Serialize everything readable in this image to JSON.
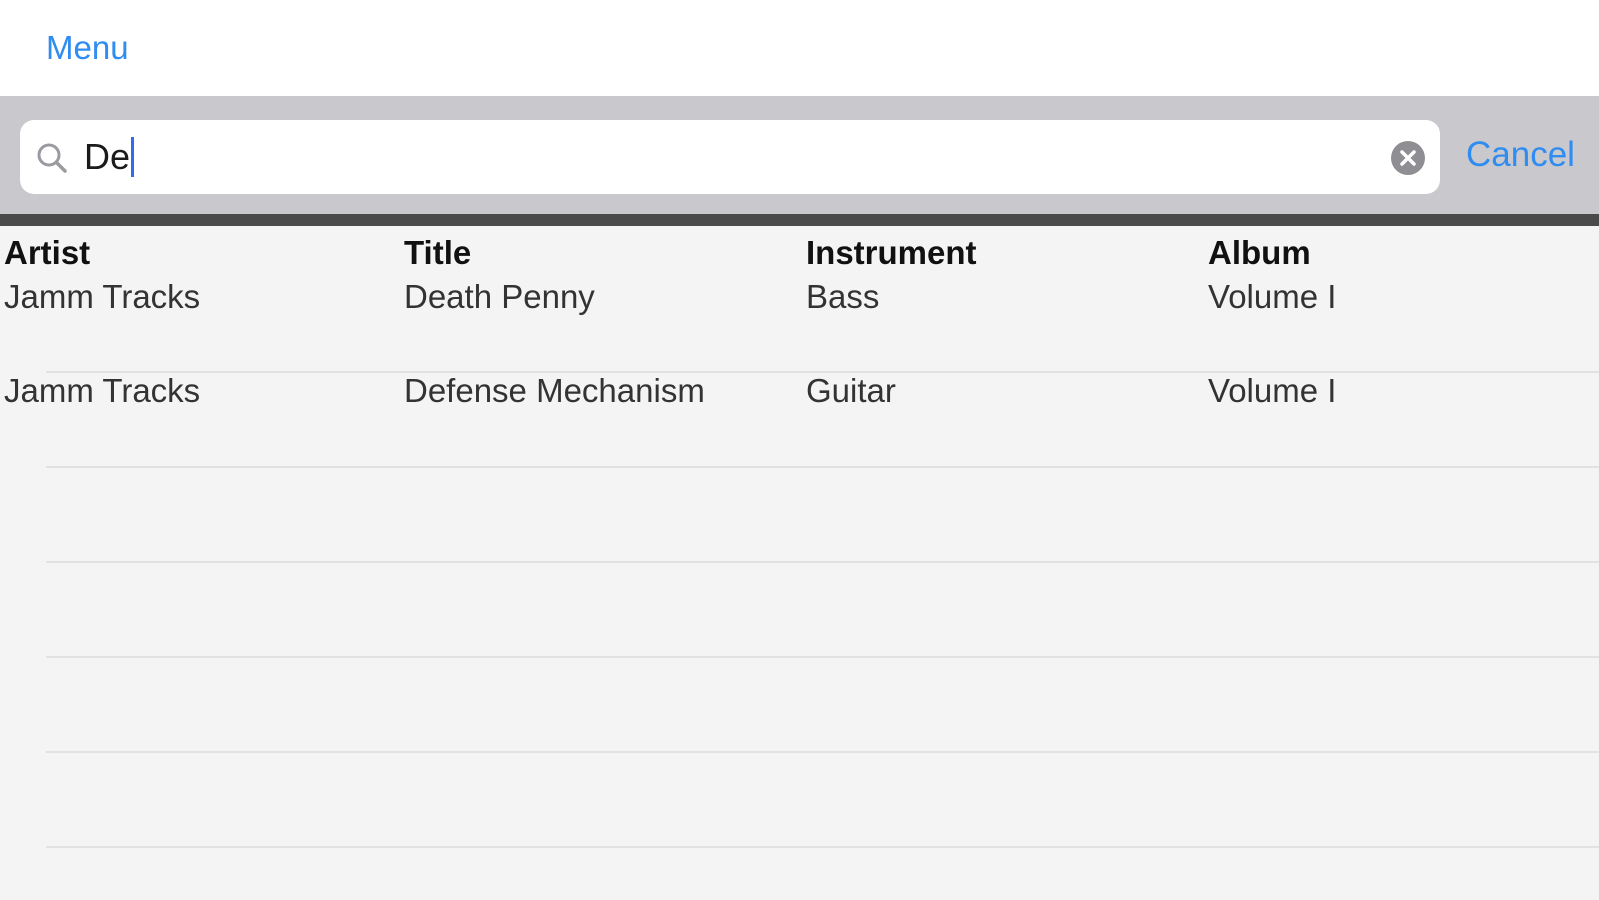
{
  "nav": {
    "menu_label": "Menu"
  },
  "search": {
    "value": "De",
    "cancel_label": "Cancel"
  },
  "table": {
    "headers": [
      "Artist",
      "Title",
      "Instrument",
      "Album"
    ],
    "rows": [
      [
        "Jamm Tracks",
        "Death Penny",
        "Bass",
        "Volume I"
      ],
      [
        "Jamm Tracks",
        "Defense Mechanism",
        "Guitar",
        "Volume I"
      ]
    ]
  },
  "colors": {
    "accent": "#2f8cf0",
    "caret": "#2f6cf0",
    "searchbar_bg": "#c8c8cd",
    "list_bg": "#f4f4f4"
  },
  "icons": {
    "search": "search-icon",
    "clear": "clear-icon"
  }
}
